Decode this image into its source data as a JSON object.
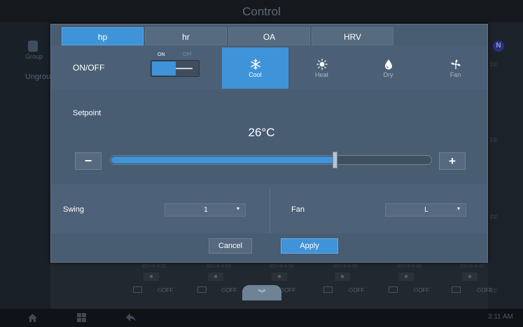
{
  "window": {
    "title": "Control"
  },
  "background": {
    "group_label": "Group",
    "ungroup_label": "Ungrou",
    "n_badge": "N",
    "right_fragments": [
      "FF",
      "FF",
      "FF",
      "FF"
    ],
    "tiles": [
      {
        "name": "IDU-0-4-32",
        "off": "OFF"
      },
      {
        "name": "IDU-0-4-33",
        "off": "OFF"
      },
      {
        "name": "IDU-0-4-34",
        "off": "OFF"
      },
      {
        "name": "IDU-0-4-35",
        "off": "OFF"
      },
      {
        "name": "IDU-0-4-36",
        "off": "OFF"
      },
      {
        "name": "IDU-0-4-37",
        "off": "OFF"
      }
    ],
    "time": "3:11 AM"
  },
  "modal": {
    "tabs": [
      {
        "label": "hp",
        "active": true
      },
      {
        "label": "hr",
        "active": false
      },
      {
        "label": "OA",
        "active": false
      },
      {
        "label": "HRV",
        "active": false
      }
    ],
    "onoff": {
      "label": "ON/OFF",
      "on_text": "ON",
      "off_text": "OFF",
      "state": "on"
    },
    "modes": [
      {
        "label": "Cool",
        "icon": "snowflake-icon",
        "active": true
      },
      {
        "label": "Heat",
        "icon": "sun-icon",
        "active": false
      },
      {
        "label": "Dry",
        "icon": "water-drop-icon",
        "active": false
      },
      {
        "label": "Fan",
        "icon": "fan-icon",
        "active": false
      }
    ],
    "setpoint": {
      "label": "Setpoint",
      "value": "26°C",
      "minus": "−",
      "plus": "+",
      "slider_fraction": 0.7
    },
    "swing": {
      "label": "Swing",
      "value": "1"
    },
    "fan": {
      "label": "Fan",
      "value": "L"
    },
    "dropdown_arrow": "▾",
    "buttons": {
      "cancel": "Cancel",
      "apply": "Apply"
    }
  },
  "colors": {
    "accent": "#3f93d8",
    "dialog": "#485c72"
  }
}
